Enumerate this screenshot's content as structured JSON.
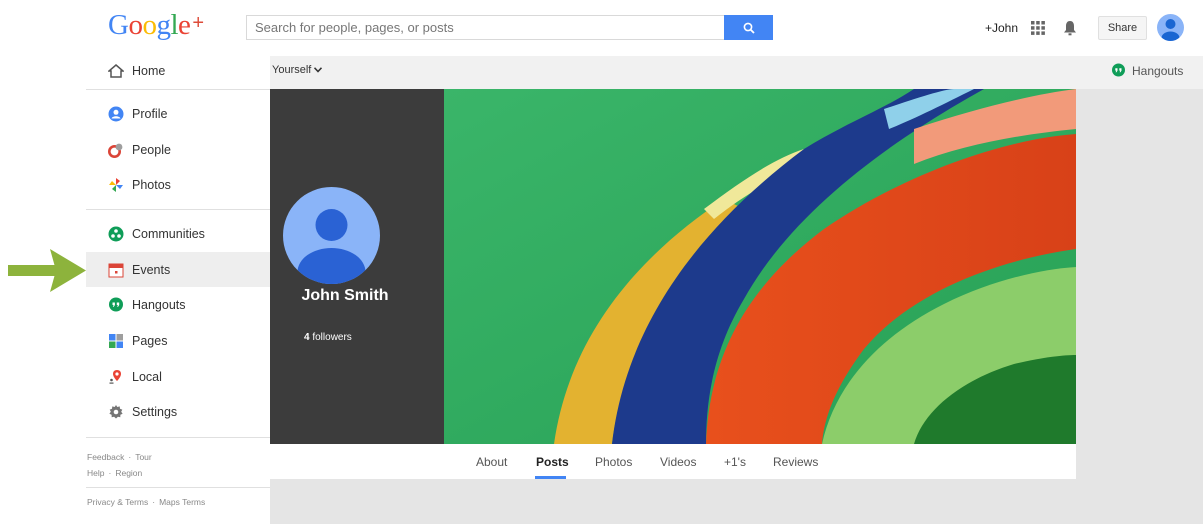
{
  "logo": {
    "text_google": "Google",
    "text_plus": "+"
  },
  "search": {
    "placeholder": "Search for people, pages, or posts"
  },
  "topbar": {
    "user_link": "+John",
    "share_label": "Share"
  },
  "subbar": {
    "filter_label": "Yourself",
    "hangouts_label": "Hangouts"
  },
  "sidebar": {
    "items": [
      {
        "label": "Home"
      },
      {
        "label": "Profile"
      },
      {
        "label": "People"
      },
      {
        "label": "Photos"
      },
      {
        "label": "Communities"
      },
      {
        "label": "Events"
      },
      {
        "label": "Hangouts"
      },
      {
        "label": "Pages"
      },
      {
        "label": "Local"
      },
      {
        "label": "Settings"
      }
    ],
    "footer": {
      "feedback": "Feedback",
      "tour": "Tour",
      "help": "Help",
      "region": "Region",
      "privacy": "Privacy & Terms",
      "maps_terms": "Maps Terms"
    }
  },
  "profile": {
    "name": "John Smith",
    "followers_count": "4",
    "followers_label": "followers"
  },
  "tabs": [
    {
      "label": "About"
    },
    {
      "label": "Posts"
    },
    {
      "label": "Photos"
    },
    {
      "label": "Videos"
    },
    {
      "label": "+1's"
    },
    {
      "label": "Reviews"
    }
  ],
  "colors": {
    "accent": "#4285f4",
    "arrow": "#8db33c",
    "profile_panel": "#3c3c3c",
    "active_item_bg": "#eeeeee"
  }
}
